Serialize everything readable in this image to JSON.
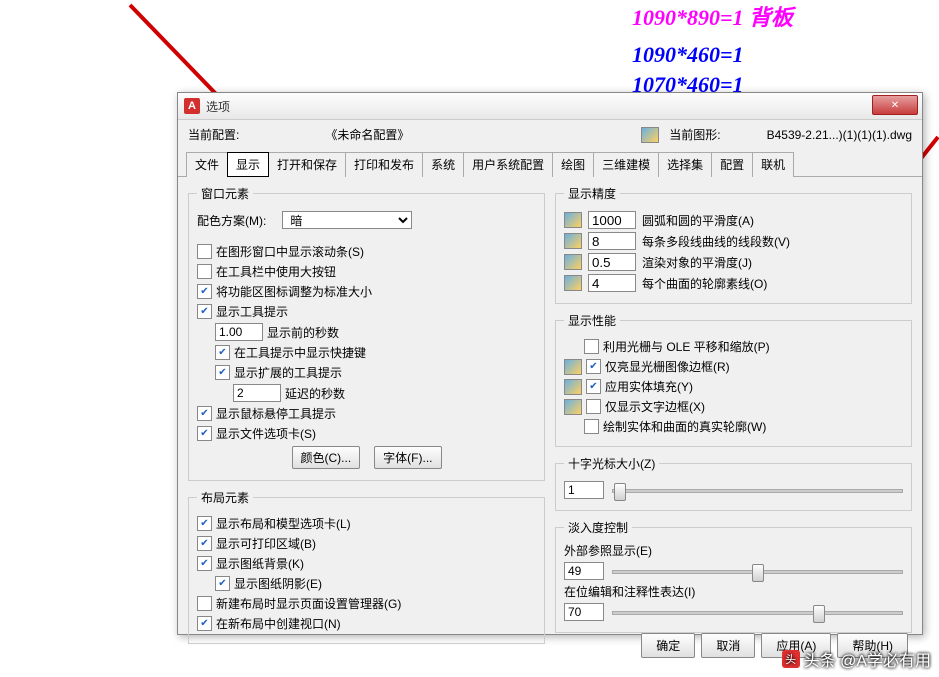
{
  "bg": {
    "l1": "1090*890=1  背板",
    "l2": "1090*460=1",
    "l3": "1070*460=1"
  },
  "dialog": {
    "title": "选项",
    "info": {
      "curprofile": "当前配置:",
      "unnamed": "《未命名配置》",
      "curdraw": "当前图形:",
      "drawname": "B4539-2.21...)(1)(1)(1).dwg"
    },
    "tabs": [
      "文件",
      "显示",
      "打开和保存",
      "打印和发布",
      "系统",
      "用户系统配置",
      "绘图",
      "三维建模",
      "选择集",
      "配置",
      "联机"
    ],
    "win": {
      "legend": "窗口元素",
      "scheme_lbl": "配色方案(M):",
      "scheme_val": "暗",
      "c1": "在图形窗口中显示滚动条(S)",
      "c2": "在工具栏中使用大按钮",
      "c3": "将功能区图标调整为标准大小",
      "c4": "显示工具提示",
      "c4a_val": "1.00",
      "c4a_lbl": "显示前的秒数",
      "c5": "在工具提示中显示快捷键",
      "c6": "显示扩展的工具提示",
      "c6a_val": "2",
      "c6a_lbl": "延迟的秒数",
      "c7": "显示鼠标悬停工具提示",
      "c8": "显示文件选项卡(S)",
      "btn_color": "颜色(C)...",
      "btn_font": "字体(F)..."
    },
    "layout": {
      "legend": "布局元素",
      "c1": "显示布局和模型选项卡(L)",
      "c2": "显示可打印区域(B)",
      "c3": "显示图纸背景(K)",
      "c4": "显示图纸阴影(E)",
      "c5": "新建布局时显示页面设置管理器(G)",
      "c6": "在新布局中创建视口(N)"
    },
    "prec": {
      "legend": "显示精度",
      "r1_v": "1000",
      "r1_l": "圆弧和圆的平滑度(A)",
      "r2_v": "8",
      "r2_l": "每条多段线曲线的线段数(V)",
      "r3_v": "0.5",
      "r3_l": "渲染对象的平滑度(J)",
      "r4_v": "4",
      "r4_l": "每个曲面的轮廓素线(O)"
    },
    "perf": {
      "legend": "显示性能",
      "c1": "利用光栅与 OLE 平移和缩放(P)",
      "c2": "仅亮显光栅图像边框(R)",
      "c3": "应用实体填充(Y)",
      "c4": "仅显示文字边框(X)",
      "c5": "绘制实体和曲面的真实轮廓(W)"
    },
    "cross": {
      "legend": "十字光标大小(Z)",
      "val": "1"
    },
    "fade": {
      "legend": "淡入度控制",
      "l1": "外部参照显示(E)",
      "v1": "49",
      "l2": "在位编辑和注释性表达(I)",
      "v2": "70"
    },
    "btns": {
      "ok": "确定",
      "cancel": "取消",
      "apply": "应用(A)",
      "help": "帮助(H)"
    }
  },
  "watermark": "头条 @A学必有用"
}
